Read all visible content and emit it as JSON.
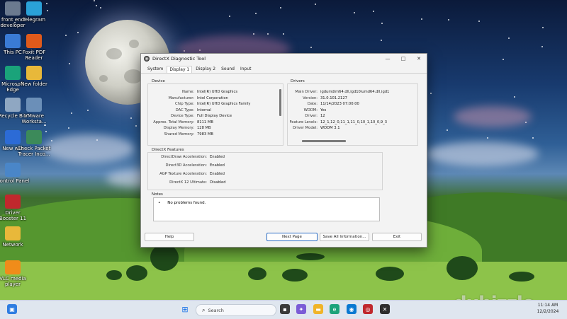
{
  "desktop_icons": [
    {
      "label": "front end\ndeveloper",
      "color": "#6b7a8f"
    },
    {
      "label": "Telegram",
      "color": "#2aa1d8"
    },
    {
      "label": "This PC",
      "color": "#3a7bd5"
    },
    {
      "label": "Foxit PDF\nReader",
      "color": "#e05a1b"
    },
    {
      "label": "Microsoft\nEdge",
      "color": "#1aa37a"
    },
    {
      "label": "New folder",
      "color": "#e8b83a"
    },
    {
      "label": "Recycle Bin",
      "color": "#8fa7c2"
    },
    {
      "label": "VMware\nWorksta...",
      "color": "#6b8fb8"
    },
    {
      "label": "New win",
      "color": "#2c6bd6"
    },
    {
      "label": "Check Packet\nTracer Inco...",
      "color": "#3c8a5a"
    },
    {
      "label": "Control Panel",
      "color": "#4a86c8"
    },
    {
      "label": "Driver\nBooster 11",
      "color": "#c0282d"
    },
    {
      "label": "Network",
      "color": "#e8b83a"
    },
    {
      "label": "VLC media\nplayer",
      "color": "#f08c1a"
    }
  ],
  "window": {
    "title": "DirectX Diagnostic Tool",
    "controls": {
      "minimize": "—",
      "maximize": "□",
      "close": "✕"
    },
    "tabs": [
      "System",
      "Display 1",
      "Display 2",
      "Sound",
      "Input"
    ],
    "active_tab": "Display 1",
    "device": {
      "title": "Device",
      "rows": [
        {
          "k": "Name:",
          "v": "Intel(R) UHD Graphics"
        },
        {
          "k": "Manufacturer:",
          "v": "Intel Corporation"
        },
        {
          "k": "Chip Type:",
          "v": "Intel(R) UHD Graphics Family"
        },
        {
          "k": "DAC Type:",
          "v": "Internal"
        },
        {
          "k": "Device Type:",
          "v": "Full Display Device"
        },
        {
          "k": "Approx. Total Memory:",
          "v": "8111 MB"
        },
        {
          "k": "Display Memory:",
          "v": "128 MB"
        },
        {
          "k": "Shared Memory:",
          "v": "7983 MB"
        }
      ]
    },
    "drivers": {
      "title": "Drivers",
      "rows": [
        {
          "k": "Main Driver:",
          "v": "igdumdim64.dll,igd10iumd64.dll,igd1"
        },
        {
          "k": "Version:",
          "v": "31.0.101.2127"
        },
        {
          "k": "Date:",
          "v": "11/14/2023 07:00:00"
        },
        {
          "k": "WDDM:",
          "v": "Yes"
        },
        {
          "k": "Driver:",
          "v": "12"
        },
        {
          "k": "Feature Levels:",
          "v": "12_1,12_0,11_1,11_0,10_1,10_0,9_3"
        },
        {
          "k": "Driver Model:",
          "v": "WDDM 3.1"
        }
      ]
    },
    "directx_features": {
      "title": "DirectX Features",
      "rows": [
        {
          "k": "DirectDraw Acceleration:",
          "v": "Enabled"
        },
        {
          "k": "Direct3D Acceleration:",
          "v": "Enabled"
        },
        {
          "k": "AGP Texture Acceleration:",
          "v": "Enabled"
        },
        {
          "k": "DirectX 12 Ultimate:",
          "v": "Disabled"
        }
      ]
    },
    "notes": {
      "title": "Notes",
      "items": [
        "No problems found."
      ]
    },
    "buttons": {
      "help": "Help",
      "next_page": "Next Page",
      "save_all": "Save All Information...",
      "exit": "Exit"
    }
  },
  "taskbar": {
    "search_placeholder": "Search",
    "clock_time": "11:14 AM",
    "clock_date": "12/2/2024"
  },
  "watermark": "dubizzle"
}
